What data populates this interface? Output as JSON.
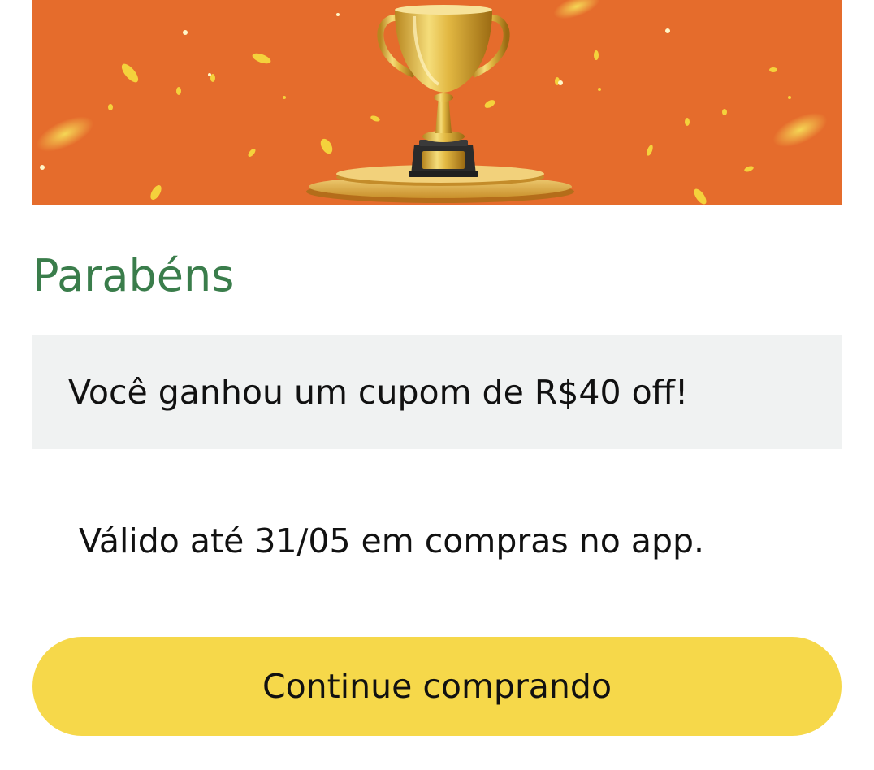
{
  "banner": {
    "background_color": "#e56c2c",
    "image_description_icon": "trophy-icon"
  },
  "title": "Parabéns",
  "message": "Você ganhou um cupom de R$40 off!",
  "validity": "Válido até 31/05 em compras no app.",
  "cta": {
    "label": "Continue comprando",
    "color": "#f6d84a"
  },
  "colors": {
    "title": "#3a7d4b",
    "message_box": "#f0f2f2",
    "text": "#111111"
  }
}
